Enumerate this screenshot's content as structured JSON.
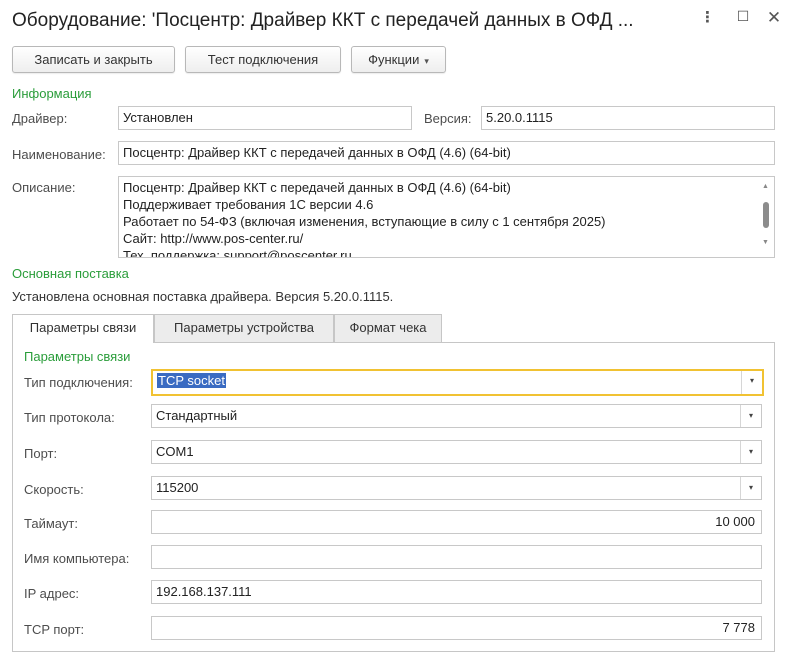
{
  "window": {
    "title": "Оборудование: 'Посцентр: Драйвер ККТ с передачей данных в ОФД ...",
    "menu_icon": "⋮",
    "maximize_icon": "☐",
    "close_icon": "✕"
  },
  "toolbar": {
    "save_close": "Записать и закрыть",
    "test_connection": "Тест подключения",
    "functions": "Функции"
  },
  "info": {
    "section_title": "Информация",
    "driver_label": "Драйвер:",
    "driver_value": "Установлен",
    "version_label": "Версия:",
    "version_value": "5.20.0.1115",
    "name_label": "Наименование:",
    "name_value": "Посцентр: Драйвер ККТ с передачей данных в ОФД (4.6) (64-bit)",
    "description_label": "Описание:",
    "description_lines": [
      "Посцентр: Драйвер ККТ с передачей данных в ОФД (4.6) (64-bit)",
      "Поддерживает требования 1С версии 4.6",
      "Работает по 54-ФЗ (включая изменения, вступающие в силу с 1 сентября 2025)",
      "Сайт: http://www.pos-center.ru/",
      "Тех. поддержка: support@poscenter.ru"
    ]
  },
  "main_delivery": {
    "section_title": "Основная поставка",
    "text": "Установлена основная поставка драйвера. Версия 5.20.0.1115."
  },
  "tabs": [
    {
      "label": "Параметры связи",
      "active": true
    },
    {
      "label": "Параметры устройства",
      "active": false
    },
    {
      "label": "Формат чека",
      "active": false
    }
  ],
  "connection": {
    "section_title": "Параметры связи",
    "connection_type_label": "Тип подключения:",
    "connection_type_value": "TCP socket",
    "protocol_label": "Тип протокола:",
    "protocol_value": "Стандартный",
    "port_label": "Порт:",
    "port_value": "COM1",
    "speed_label": "Скорость:",
    "speed_value": "115200",
    "timeout_label": "Таймаут:",
    "timeout_value": "10 000",
    "computer_name_label": "Имя компьютера:",
    "computer_name_value": "",
    "ip_label": "IP адрес:",
    "ip_value": "192.168.137.111",
    "tcp_port_label": "TCP порт:",
    "tcp_port_value": "7 778"
  },
  "colors": {
    "section_green": "#2a9d3a",
    "focus_border": "#f1c232",
    "selection_blue": "#3a6bc2"
  },
  "icons": {
    "dropdown": "▾",
    "scroll_up": "▲",
    "scroll_down": "▼"
  }
}
